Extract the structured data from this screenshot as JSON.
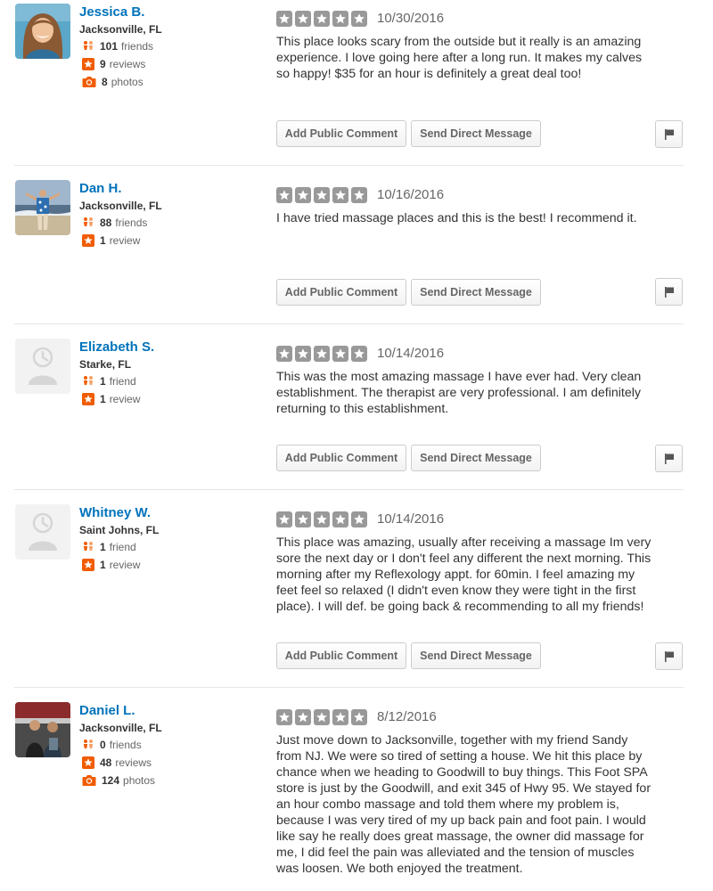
{
  "reviews": [
    {
      "name": "Jessica B.",
      "location": "Jacksonville, FL",
      "friends_count": "101",
      "friends_label": "friends",
      "reviews_count": "9",
      "reviews_label": "reviews",
      "photos_count": "8",
      "photos_label": "photos",
      "rating": 5,
      "date": "10/30/2016",
      "lines": [
        "This place looks scary from the outside but it really is an amazing",
        "experience. I love going here after a long run. It makes my calves",
        "so happy! $35 for an hour is definitely a great deal too!"
      ]
    },
    {
      "name": "Dan H.",
      "location": "Jacksonville, FL",
      "friends_count": "88",
      "friends_label": "friends",
      "reviews_count": "1",
      "reviews_label": "review",
      "rating": 5,
      "date": "10/16/2016",
      "lines": [
        "I have tried massage places and this is the best! I recommend it."
      ]
    },
    {
      "name": "Elizabeth S.",
      "location": "Starke, FL",
      "friends_count": "1",
      "friends_label": "friend",
      "reviews_count": "1",
      "reviews_label": "review",
      "rating": 5,
      "date": "10/14/2016",
      "lines": [
        "This was the most amazing massage I have ever had.  Very clean",
        "establishment. The therapist are very professional. I am definitely",
        "returning to this establishment."
      ]
    },
    {
      "name": "Whitney W.",
      "location": "Saint Johns, FL",
      "friends_count": "1",
      "friends_label": "friend",
      "reviews_count": "1",
      "reviews_label": "review",
      "rating": 5,
      "date": "10/14/2016",
      "lines": [
        "This place was amazing, usually after receiving a massage Im very",
        "sore the next day or I don't feel any different the next morning. This",
        "morning after my Reflexology appt. for 60min. I feel amazing my",
        "feet feel so relaxed (I didn't even know they were tight in the first",
        "place). I will def. be going back & recommending to all my friends!"
      ]
    },
    {
      "name": "Daniel L.",
      "location": "Jacksonville, FL",
      "friends_count": "0",
      "friends_label": "friends",
      "reviews_count": "48",
      "reviews_label": "reviews",
      "photos_count": "124",
      "photos_label": "photos",
      "rating": 5,
      "date": "8/12/2016",
      "lines": [
        "Just move down to Jacksonville, together with my friend Sandy",
        "from NJ. We were so tired of setting a house. We hit this place by",
        "chance when we heading to Goodwill to buy things. This Foot SPA",
        "store is just by the Goodwill, and exit 345 of Hwy 95. We stayed for",
        "an hour combo massage and told them where my problem is,",
        "because I was very tired of my up back pain and foot pain. I would",
        "like say he really does great massage, the owner did massage for",
        "me, I did feel the pain was alleviated and the tension of muscles",
        "was loosen. We both enjoyed the treatment."
      ]
    }
  ],
  "actions": {
    "comment_label": "Add Public Comment",
    "message_label": "Send Direct Message"
  },
  "colors": {
    "name_link": "#0073bb",
    "star_gray": "#999999",
    "social_orange": "#f15c00",
    "divider": "#e6e6e6"
  },
  "icons": {
    "friends": "friends-icon",
    "reviews": "review-star-icon",
    "photos": "camera-icon",
    "flag": "flag-icon",
    "rating_star": "star-icon"
  }
}
